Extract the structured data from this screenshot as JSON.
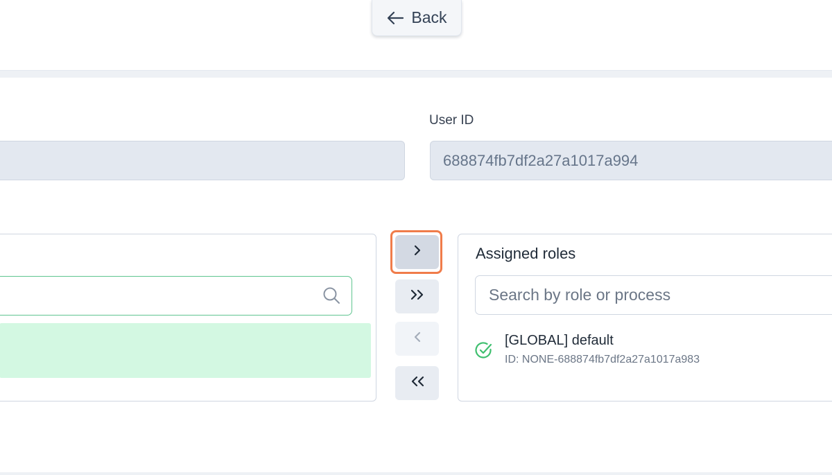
{
  "header": {
    "back_label": "Back"
  },
  "user_form": {
    "user_id_label": "User ID",
    "user_id_value": "688874fb7df2a27a1017a994"
  },
  "available_panel": {
    "search_placeholder": ""
  },
  "assigned_panel": {
    "title": "Assigned roles",
    "search_placeholder": "Search by role or process",
    "roles": [
      {
        "name": "[GLOBAL] default",
        "id": "ID: NONE-688874fb7df2a27a1017a983"
      }
    ]
  },
  "transfer_buttons": {
    "move_one": ">",
    "move_all": ">>",
    "remove_one": "<",
    "remove_all": "<<"
  },
  "colors": {
    "accent_green": "#5ec48f",
    "selected_row": "#d3f8e2",
    "highlight": "#f07c4a"
  }
}
